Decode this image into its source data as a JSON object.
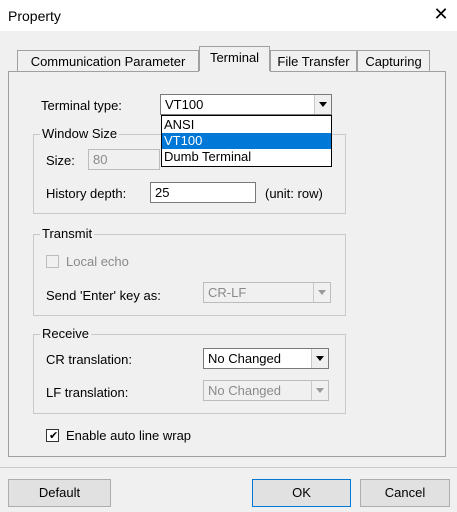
{
  "window": {
    "title": "Property",
    "close_glyph": "✕"
  },
  "tabs": [
    {
      "label": "Communication Parameter",
      "active": false
    },
    {
      "label": "Terminal",
      "active": true
    },
    {
      "label": "File Transfer",
      "active": false
    },
    {
      "label": "Capturing",
      "active": false
    }
  ],
  "terminal_type": {
    "label": "Terminal type:",
    "value": "VT100",
    "options": [
      "ANSI",
      "VT100",
      "Dumb Terminal"
    ],
    "selected_index": 1
  },
  "window_size": {
    "group_title": "Window Size",
    "size_label": "Size:",
    "size_value": "80",
    "history_label": "History depth:",
    "history_value": "25",
    "history_unit": "(unit: row)"
  },
  "transmit": {
    "group_title": "Transmit",
    "local_echo_label": "Local echo",
    "local_echo_checked": false,
    "send_enter_label": "Send 'Enter' key  as:",
    "send_enter_value": "CR-LF"
  },
  "receive": {
    "group_title": "Receive",
    "cr_label": "CR translation:",
    "cr_value": "No Changed",
    "lf_label": "LF translation:",
    "lf_value": "No Changed"
  },
  "auto_wrap": {
    "label": "Enable auto line wrap",
    "checked": true,
    "check_glyph": "✔"
  },
  "buttons": {
    "default": "Default",
    "ok": "OK",
    "cancel": "Cancel"
  }
}
